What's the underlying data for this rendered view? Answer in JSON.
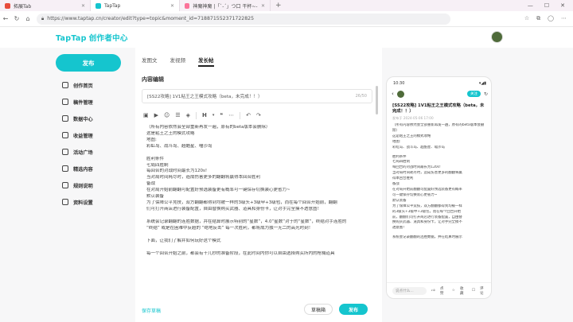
{
  "browser": {
    "tabs": [
      {
        "title": "拓展Tab",
        "active": false
      },
      {
        "title": "TapTap",
        "active": true
      },
      {
        "title": "神魔神魔 |「ˋ-ˊ」つ口 干杯~-bili",
        "active": false
      }
    ],
    "url": "https://www.taptap.cn/creator/edit?type=topic&moment_id=718871552371722825"
  },
  "header": {
    "logo": "TapTap",
    "logo_sub": "创作者中心"
  },
  "sidebar": {
    "publish": "发布",
    "items": [
      "创作首页",
      "稿件管理",
      "数据中心",
      "收益管理",
      "活动广场",
      "精选内容",
      "规则说明",
      "资料设置"
    ]
  },
  "editor": {
    "tabs": [
      "发图文",
      "发视频",
      "发长帖"
    ],
    "section_title": "内容编辑",
    "title_value": "[SS22攻略] 1V1粘王之王模式攻略（beta，未完成！！）",
    "title_count": "26/50",
    "body": [
      "（所有内容依然会全部重新再发一遍，原有的beta版本会删除）",
      "这是粘王之王的模式攻略",
      "地图:",
      "彩虹岛、战斗岛、超酷星、喵沙岛",
      "",
      "胜利条件",
      "七局四胜制",
      "每回合的对战时间最长为120s!",
      "当对局时间耗尽时，造成伤害更多的翻翻将赢得本回合胜利",
      "备战",
      "在对局开始前翻翻可配置好预选装备更有概率可一键保存切换装心更省力~",
      "默认装备",
      "为了保障公平竞技，双方翻翻都得到均被一样的3级头+3级甲+3级包，而在每个回合开始前，翻翻",
      "们可打开商店进行装备配置，自由替换购买武器、道具和身份卡，让对手完全摸不透意图！",
      "",
      "系统会记录翻翻的连胜数据，并在结算时展示特别的“星数”，4.0”星数”对于的“星数”，终结对手连胜的",
      "“终结” 或是在困难中反超的 “绝地反击” 每一次胜利，都将成为独一无二的高光时刻！",
      "",
      "下面，让我们了解并如何玩好这个模式",
      "",
      "每一个回合开始之前，都会有十几秒的准备阶段，在此时间内你可以自由选择购买所内的枪械道具"
    ],
    "save_draft": "保存草稿",
    "drafts_button": "草稿箱",
    "post_button": "发布"
  },
  "preview": {
    "time": "10:30",
    "follow": "关注",
    "title": "[SS22攻略] 1V1粘王之王模式攻略（beta，未完成！！）",
    "date": "发布于 2024-05-06 17:00",
    "body": [
      "（所有内容依然会全部重新再发一遍，原有的beta版本会删除）",
      "这是粘王之王的模式攻略",
      "地图:",
      "彩虹岛、战斗岛、超酷星、喵沙岛",
      "",
      "胜利条件",
      "七局四胜制",
      "每回合的对战时间最长为120s!",
      "当对局时间耗尽时，造成伤害更多的翻翻将赢",
      "得本回合胜利",
      "备战",
      "在对局开始前翻翻可配置好预选装备更有概率",
      "可一键保存切换装心更省力~",
      "默认装备",
      "为了保障公平竞技，双方翻翻都得到均被一样",
      "的3级头+3级甲+3级包，而在每个回合开始",
      "前，翻翻们可打开商店进行装备配置，自由替",
      "换购买武器、道具和身份卡，让对手完全摸不",
      "透意图！",
      "",
      "系统会记录翻翻的连胜数据，并在结算时展示"
    ],
    "comment_placeholder": "说点什么...",
    "actions": [
      "点赞",
      "收藏",
      "评论"
    ]
  }
}
